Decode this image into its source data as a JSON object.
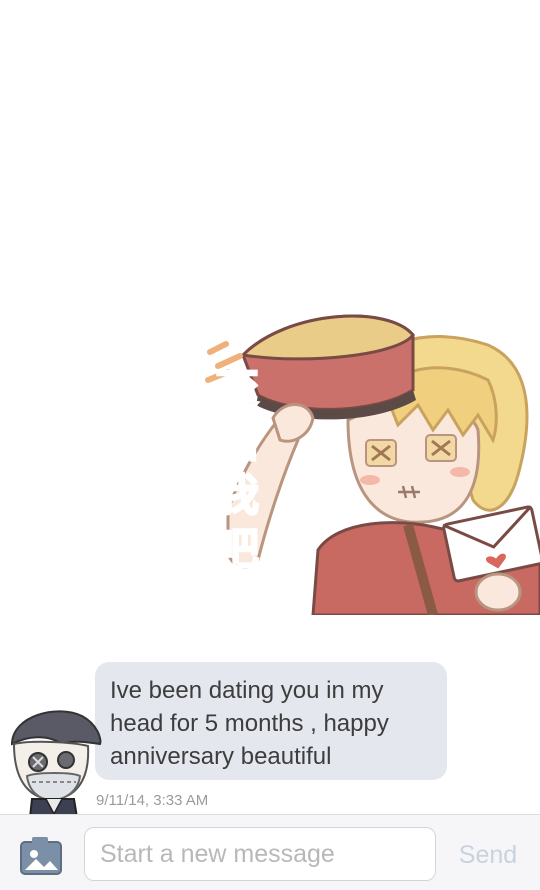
{
  "sticker": {
    "caption_chars": [
      "交",
      "給",
      "我",
      "吧"
    ],
    "icon": "chibi-bellboy-sticker"
  },
  "message": {
    "text": "Ive been dating you in my head for 5 months , happy anniversary beautiful",
    "timestamp": "9/11/14, 3:33 AM",
    "avatar_icon": "chibi-avatar"
  },
  "compose": {
    "placeholder": "Start a new message",
    "value": "",
    "send_label": "Send",
    "photo_icon": "photo-camera-icon"
  },
  "colors": {
    "bubble": "#e4e7ee",
    "send_disabled": "#c9d2e0",
    "sticker_text": "#f0b07a"
  }
}
